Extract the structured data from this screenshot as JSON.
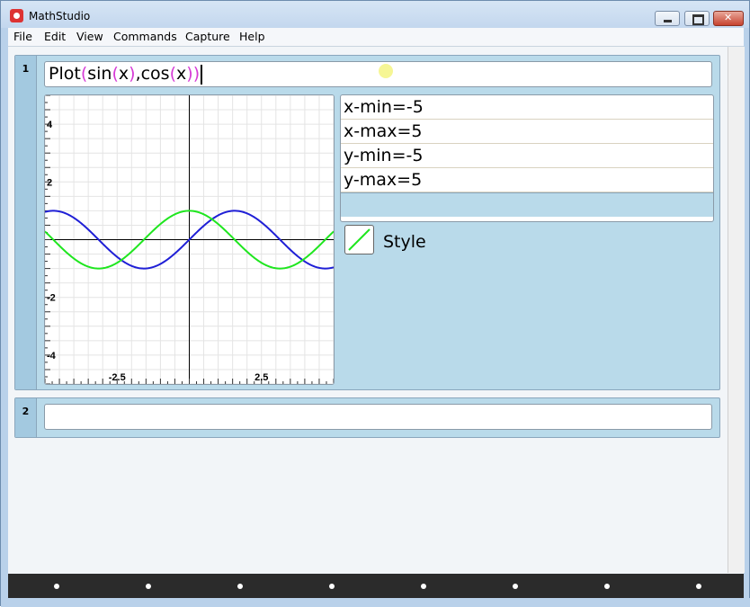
{
  "window": {
    "title": "MathStudio"
  },
  "menu": [
    "File",
    "Edit",
    "View",
    "Commands",
    "Capture",
    "Help"
  ],
  "cells": [
    {
      "number": "1",
      "expression": {
        "func": "Plot",
        "open1": "(",
        "arg1_func": "sin",
        "open2": "(",
        "arg1_var": "x",
        "close2": ")",
        "comma": ",",
        "arg2_func": "cos",
        "open3": "(",
        "arg2_var": "x",
        "close3": ")",
        "close1": ")"
      },
      "params": [
        "x-min=-5",
        "x-max=5",
        "y-min=-5",
        "y-max=5"
      ],
      "style_label": "Style"
    },
    {
      "number": "2",
      "expression": ""
    }
  ],
  "colors": {
    "sin": "#1f1fd6",
    "cos": "#1fe61f",
    "paren": "#d63ad6",
    "accent": "#b9daea"
  },
  "chart_data": {
    "type": "line",
    "xlim": [
      -5,
      5
    ],
    "ylim": [
      -5,
      5
    ],
    "grid": true,
    "x_ticks": [
      "-2.5",
      "2.5"
    ],
    "y_ticks": [
      "4",
      "2",
      "-2",
      "-4"
    ],
    "series": [
      {
        "name": "sin(x)",
        "function": "sin",
        "x": [
          -5,
          -4,
          -3,
          -2,
          -1,
          0,
          1,
          2,
          3,
          4,
          5
        ],
        "y": [
          0.96,
          0.76,
          -0.14,
          -0.91,
          -0.84,
          0,
          0.84,
          0.91,
          0.14,
          -0.76,
          -0.96
        ]
      },
      {
        "name": "cos(x)",
        "function": "cos",
        "x": [
          -5,
          -4,
          -3,
          -2,
          -1,
          0,
          1,
          2,
          3,
          4,
          5
        ],
        "y": [
          0.28,
          -0.65,
          -0.99,
          -0.42,
          0.54,
          1,
          0.54,
          -0.42,
          -0.99,
          -0.65,
          0.28
        ]
      }
    ]
  }
}
